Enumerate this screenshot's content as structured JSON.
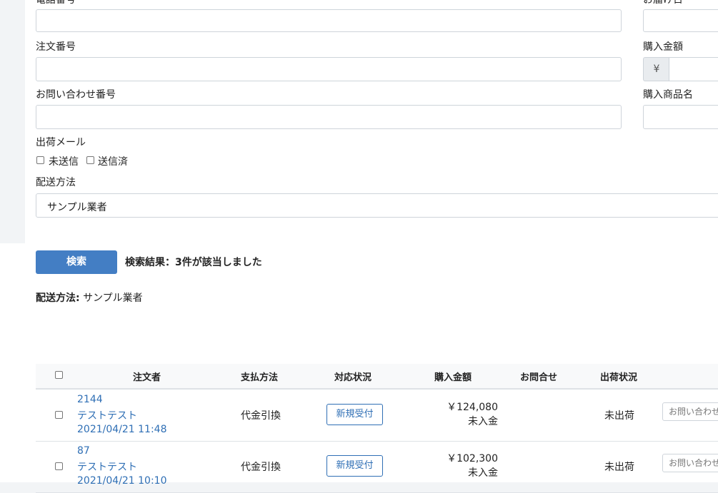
{
  "form": {
    "phone_label": "電話番号",
    "delivery_date_label": "お届け日",
    "order_number_label": "注文番号",
    "purchase_amount_label": "購入金額",
    "currency_symbol": "¥",
    "inquiry_number_label": "お問い合わせ番号",
    "product_name_label": "購入商品名",
    "shipping_mail_label": "出荷メール",
    "shipping_mail_options": [
      "未送信",
      "送信済"
    ],
    "delivery_method_label": "配送方法",
    "delivery_method_value": "サンプル業者"
  },
  "search": {
    "button_label": "検索",
    "result_text": "検索結果：3件が該当しました",
    "filter_label": "配送方法:",
    "filter_value": "サンプル業者"
  },
  "table": {
    "headers": [
      "注文者",
      "支払方法",
      "対応状況",
      "購入金額",
      "お問合せ",
      "出荷状況"
    ],
    "rows": [
      {
        "id": "2144",
        "name": "テストテスト",
        "date": "2021/04/21 11:48",
        "payment": "代金引換",
        "status": "新規受付",
        "amount": "￥124,080",
        "payment_status": "未入金",
        "shipping": "未出荷",
        "inquiry": "お問い合わせ"
      },
      {
        "id": "87",
        "name": "テストテスト",
        "date": "2021/04/21 10:10",
        "payment": "代金引換",
        "status": "新規受付",
        "amount": "￥102,300",
        "payment_status": "未入金",
        "shipping": "未出荷",
        "inquiry": "お問い合わせ"
      }
    ]
  }
}
